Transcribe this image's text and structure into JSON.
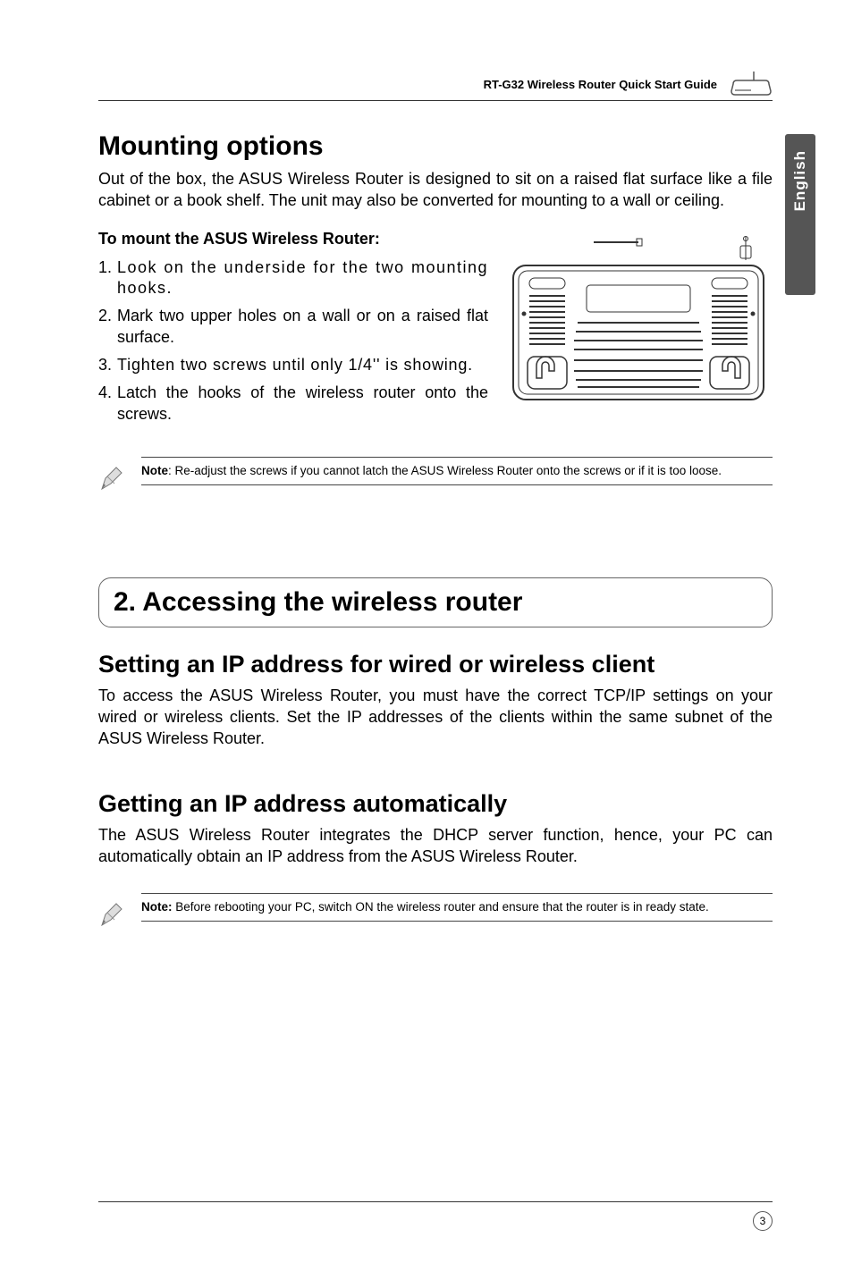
{
  "header": {
    "doc_title": "RT-G32 Wireless Router Quick Start Guide"
  },
  "side_tab": "English",
  "mounting": {
    "heading": "Mounting options",
    "intro": "Out of the box, the ASUS Wireless Router is designed to sit on a raised flat surface like a file cabinet or a book shelf. The unit may also be converted for mounting to a wall or ceiling.",
    "to_mount": "To mount the ASUS Wireless Router:",
    "steps": [
      {
        "n": "1.",
        "t": "Look on the underside for the two mounting hooks."
      },
      {
        "n": "2.",
        "t": "Mark two upper holes on a wall or on a raised flat surface."
      },
      {
        "n": "3.",
        "t": "Tighten two screws until only 1/4'' is showing."
      },
      {
        "n": "4.",
        "t": "Latch the hooks of the wireless router onto the screws."
      }
    ],
    "note_label": "Note",
    "note_text": ": Re-adjust the screws if you cannot latch the ASUS Wireless Router onto the screws or if it is too loose."
  },
  "section2": {
    "title": "2. Accessing the wireless router",
    "sub1_heading": "Setting an IP address for wired or wireless client",
    "sub1_body": "To access the ASUS Wireless Router, you must have the correct TCP/IP settings on your wired or wireless clients. Set the IP addresses of the clients within the same subnet of the ASUS Wireless Router.",
    "sub2_heading": "Getting an IP address automatically",
    "sub2_body": "The ASUS Wireless Router integrates the DHCP server function, hence, your PC can automatically obtain an IP address from the ASUS Wireless Router.",
    "note_label": "Note:",
    "note_text": " Before rebooting your PC, switch ON the wireless router and ensure that the router is in ready state."
  },
  "footer": {
    "page_number": "3"
  }
}
